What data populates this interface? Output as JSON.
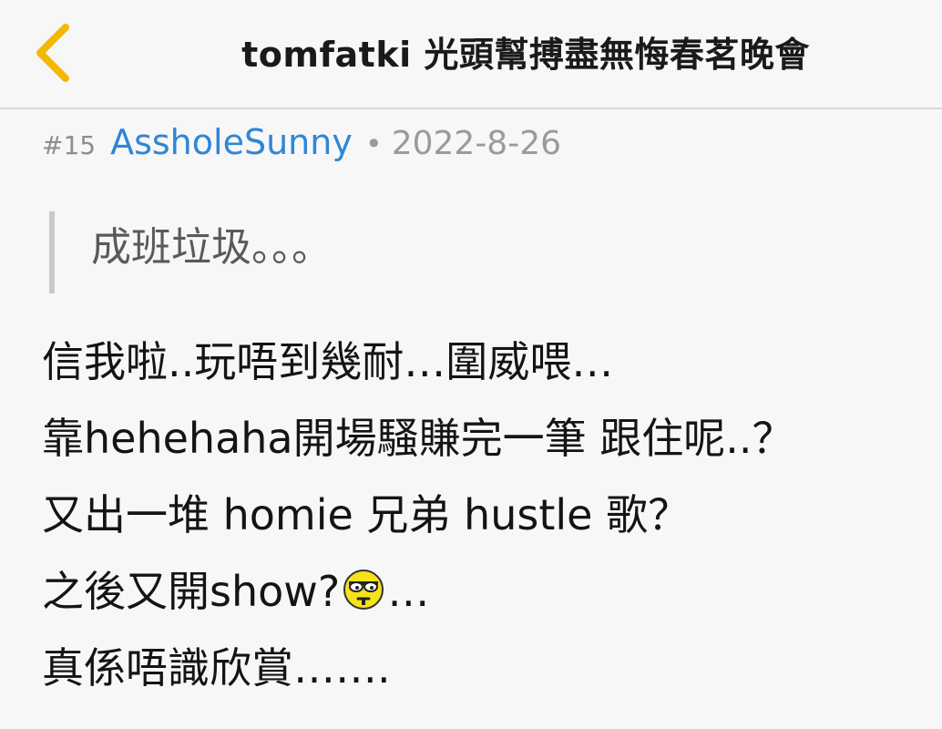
{
  "nav": {
    "back_icon": "chevron-left-icon",
    "title": "tomfatki 光頭幫搏盡無悔春茗晚會",
    "accent_color": "#f5b800"
  },
  "post": {
    "number": "#15",
    "username": "AssholeSunny",
    "separator": "•",
    "date": "2022-8-26",
    "username_color": "#2f86d6",
    "quote": "成班垃圾。。。",
    "lines": [
      {
        "text": "信我啦..玩唔到幾耐…圍威喂…"
      },
      {
        "text": "靠hehehaha開場騷賺完一筆 跟住呢..？"
      },
      {
        "text": "又出一堆 homie 兄弟 hustle 歌？"
      },
      {
        "before": "之後又開show?",
        "emoji": "sunglasses-smiley-icon",
        "after": "…"
      },
      {
        "text": "真係唔識欣賞……."
      }
    ]
  }
}
